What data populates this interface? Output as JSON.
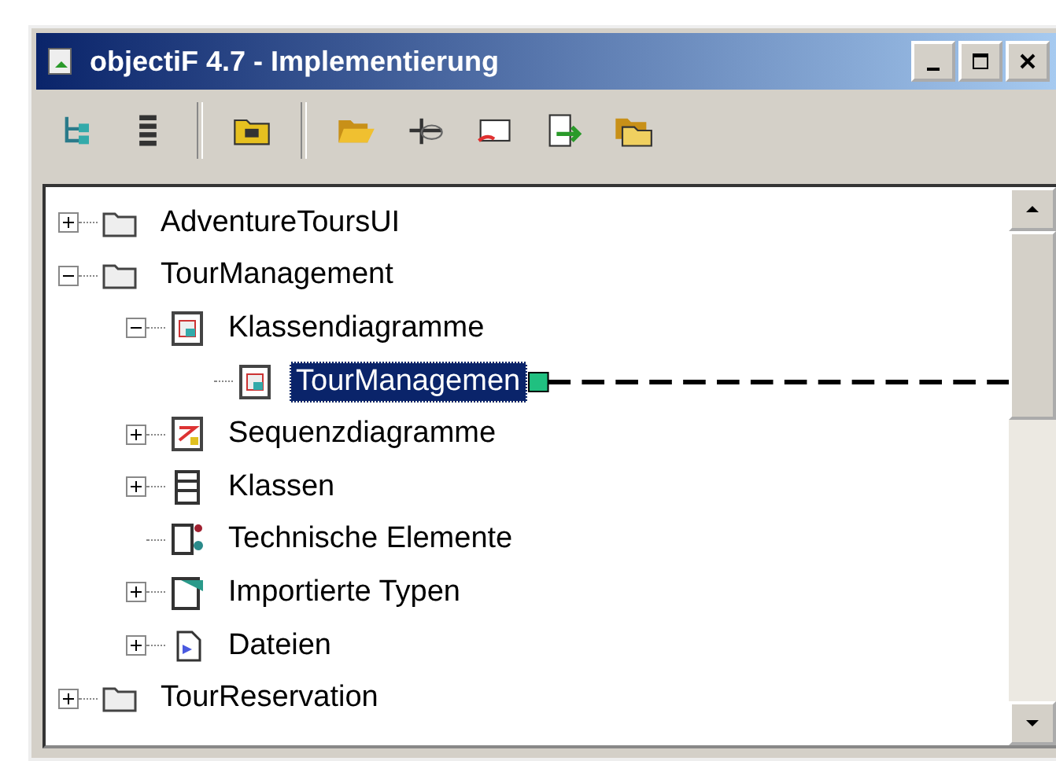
{
  "window": {
    "title": "objectiF 4.7 - Implementierung"
  },
  "tree": [
    {
      "label": "AdventureToursUI",
      "kind": "folder",
      "expanded": false,
      "selected": false
    },
    {
      "label": "TourManagement",
      "kind": "folder",
      "expanded": true,
      "selected": false,
      "children": [
        {
          "label": "Klassendiagramme",
          "kind": "class-diagrams",
          "expanded": true,
          "selected": false,
          "children": [
            {
              "label": "TourManagemen",
              "kind": "diagram",
              "selected": true
            }
          ]
        },
        {
          "label": "Sequenzdiagramme",
          "kind": "sequence-diagrams",
          "expanded": false,
          "selected": false
        },
        {
          "label": "Klassen",
          "kind": "classes",
          "expanded": false,
          "selected": false
        },
        {
          "label": "Technische Elemente",
          "kind": "technical",
          "selected": false
        },
        {
          "label": "Importierte Typen",
          "kind": "imported",
          "expanded": false,
          "selected": false
        },
        {
          "label": "Dateien",
          "kind": "files",
          "expanded": false,
          "selected": false
        }
      ]
    },
    {
      "label": "TourReservation",
      "kind": "folder",
      "expanded": false,
      "selected": false
    }
  ]
}
